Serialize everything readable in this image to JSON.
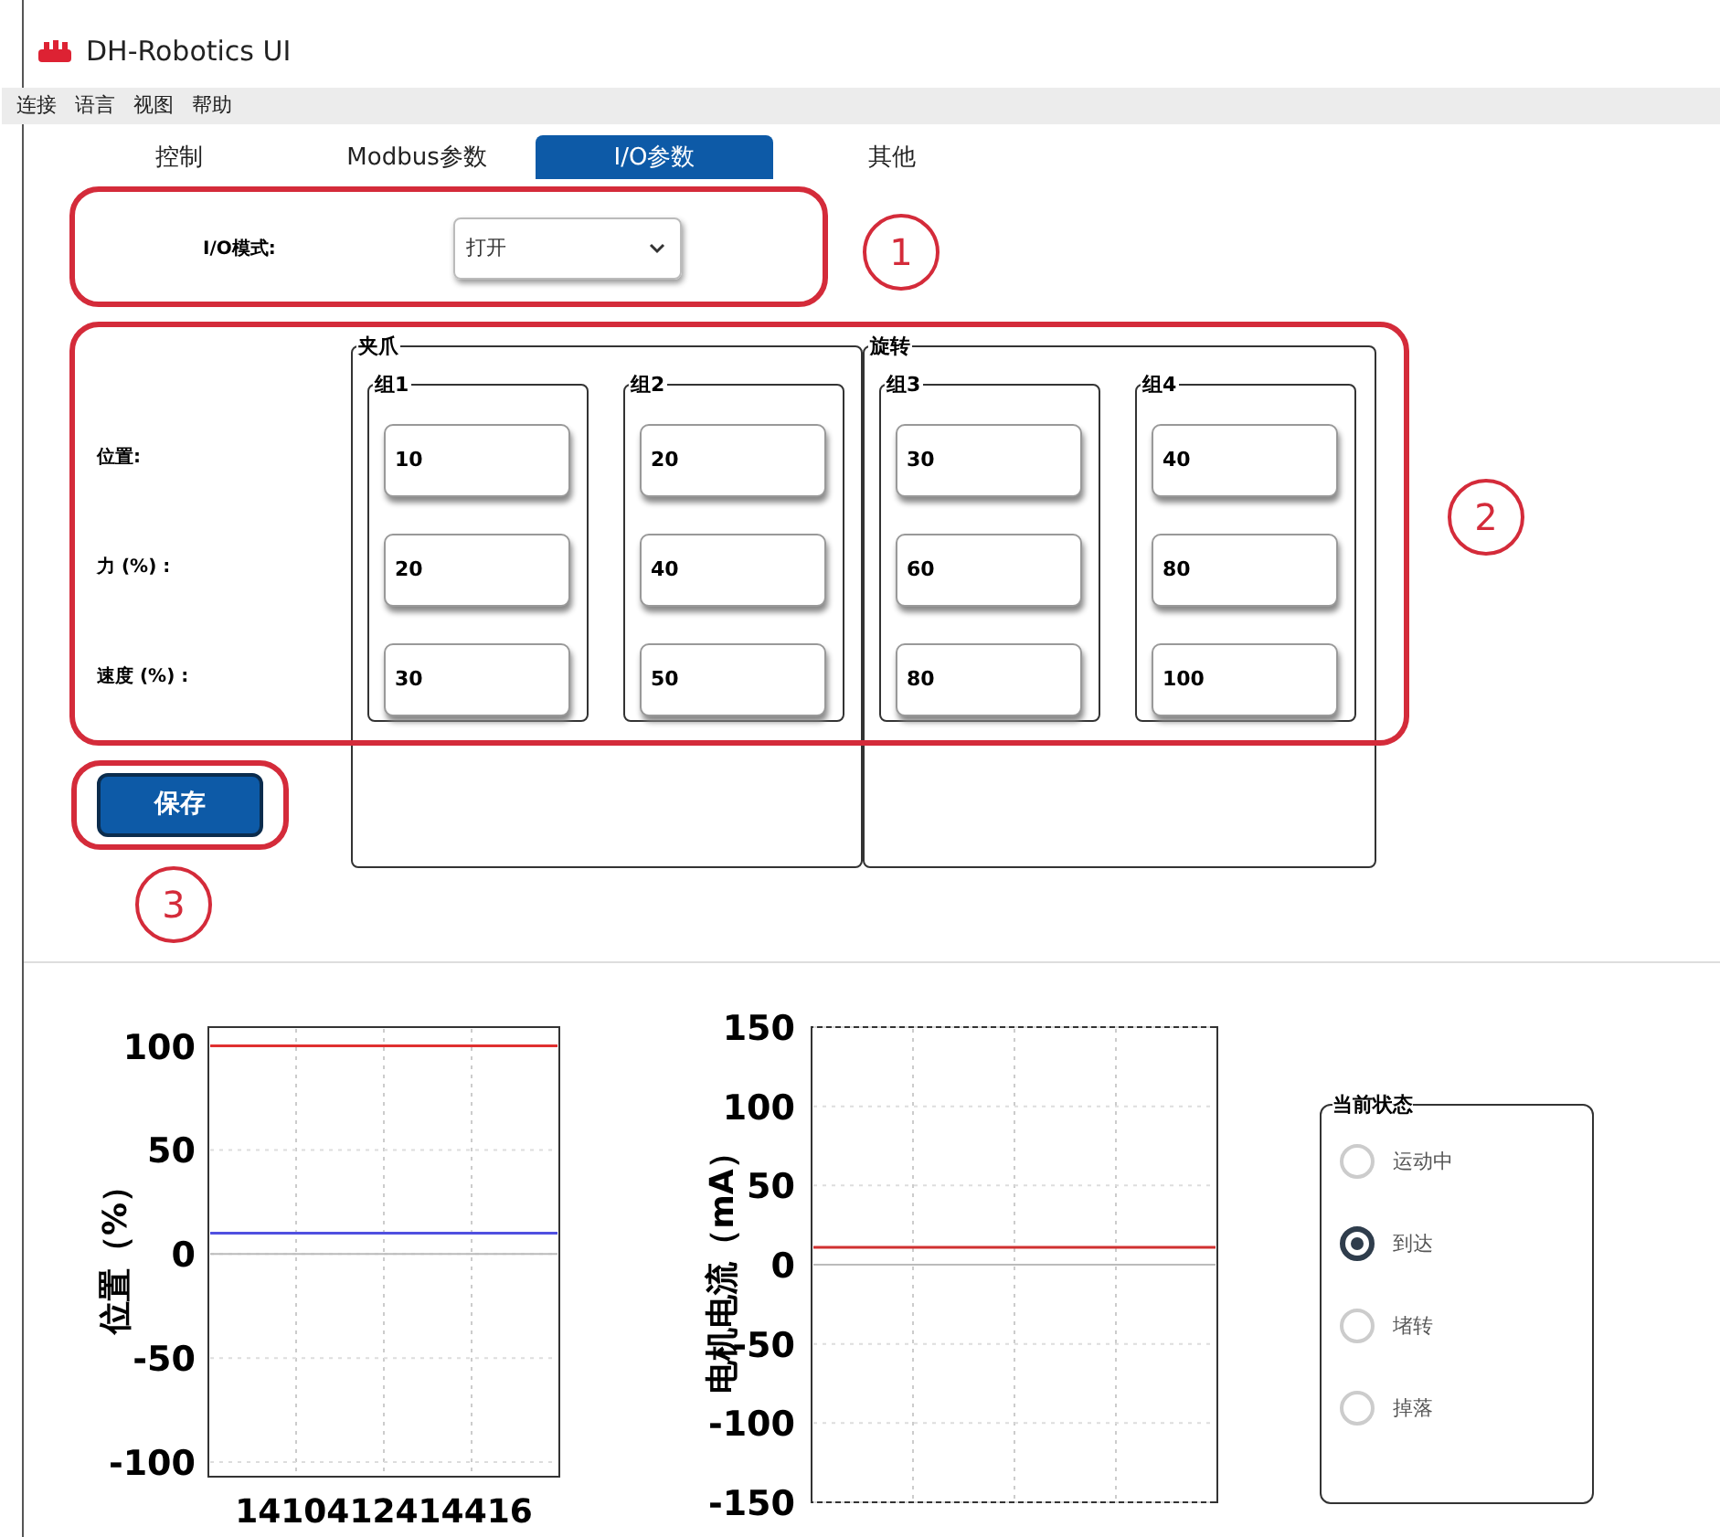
{
  "window": {
    "title": "DH-Robotics UI"
  },
  "menu": [
    "连接",
    "语言",
    "视图",
    "帮助"
  ],
  "tabs": [
    {
      "label": "控制",
      "selected": false
    },
    {
      "label": "Modbus参数",
      "selected": false
    },
    {
      "label": "I/O参数",
      "selected": true
    },
    {
      "label": "其他",
      "selected": false
    }
  ],
  "io_mode": {
    "label": "I/O模式:",
    "value": "打开"
  },
  "row_labels": [
    "位置:",
    "力 (%) :",
    "速度 (%) :"
  ],
  "sections": [
    {
      "title": "夹爪",
      "groups": [
        {
          "title": "组1",
          "values": [
            "10",
            "20",
            "30"
          ]
        },
        {
          "title": "组2",
          "values": [
            "20",
            "40",
            "50"
          ]
        }
      ]
    },
    {
      "title": "旋转",
      "groups": [
        {
          "title": "组3",
          "values": [
            "30",
            "60",
            "80"
          ]
        },
        {
          "title": "组4",
          "values": [
            "40",
            "80",
            "100"
          ]
        }
      ]
    }
  ],
  "save_button": "保存",
  "annotations": [
    "1",
    "2",
    "3"
  ],
  "position_chart": {
    "x_tick_text": "1410412414416",
    "chart_data": {
      "type": "line",
      "ylabel": "位置（%）",
      "ylim": [
        -107,
        109
      ],
      "yticks": [
        100,
        50,
        0,
        -50,
        -100
      ],
      "grid": true,
      "series": [
        {
          "color": "#e03030",
          "values": [
            100,
            100,
            100,
            100,
            100,
            100,
            100,
            100,
            100,
            100
          ]
        },
        {
          "color": "#5050e0",
          "values": [
            10,
            10,
            10,
            10,
            10,
            10,
            10,
            10,
            10,
            10
          ]
        }
      ]
    }
  },
  "current_chart": {
    "chart_data": {
      "type": "line",
      "ylabel": "电机电流（mA）",
      "ylim": [
        -150,
        150
      ],
      "yticks": [
        150,
        100,
        50,
        0,
        -50,
        -100,
        -150
      ],
      "grid": true,
      "series": [
        {
          "color": "#d03030",
          "values": [
            11,
            11,
            11,
            11,
            11,
            11,
            11,
            11,
            11,
            11
          ]
        }
      ]
    }
  },
  "status": {
    "title": "当前状态",
    "options": [
      {
        "label": "运动中",
        "selected": false
      },
      {
        "label": "到达",
        "selected": true
      },
      {
        "label": "堵转",
        "selected": false
      },
      {
        "label": "掉落",
        "selected": false
      }
    ]
  }
}
